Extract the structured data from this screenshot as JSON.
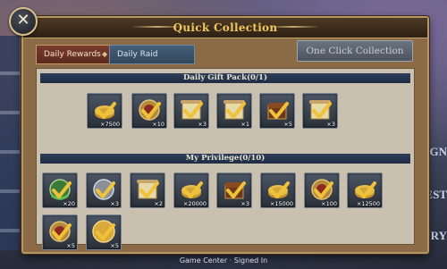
{
  "window": {
    "title": "Quick Collection"
  },
  "tabs": [
    {
      "label": "Daily Rewards",
      "active": true
    },
    {
      "label": "Daily Raid",
      "active": false
    }
  ],
  "one_click_label": "One Click Collection",
  "daily_gift": {
    "header": "Daily Gift Pack(0/1)",
    "items": [
      {
        "icon": "gold-coins-icon",
        "qty": "×7500"
      },
      {
        "icon": "medal-badge-icon",
        "qty": "×10"
      },
      {
        "icon": "scroll-icon",
        "qty": "×3"
      },
      {
        "icon": "scroll-icon",
        "qty": "×1"
      },
      {
        "icon": "chest-icon",
        "qty": "×5"
      },
      {
        "icon": "scroll-icon",
        "qty": "×3"
      }
    ]
  },
  "privilege": {
    "header": "My Privilege(0/10)",
    "items": [
      {
        "icon": "green-emblem-icon",
        "qty": "×20"
      },
      {
        "icon": "silver-shield-icon",
        "qty": "×3"
      },
      {
        "icon": "scroll-icon",
        "qty": "×2"
      },
      {
        "icon": "gold-coins-icon",
        "qty": "×20000"
      },
      {
        "icon": "chest-icon",
        "qty": "×3"
      },
      {
        "icon": "gold-coins-icon",
        "qty": "×15000"
      },
      {
        "icon": "medal-badge-icon",
        "qty": "×100"
      },
      {
        "icon": "gold-coins-icon",
        "qty": "×12500"
      },
      {
        "icon": "medal-badge-icon",
        "qty": "×5"
      },
      {
        "icon": "gold-medal-icon",
        "qty": "×5"
      }
    ]
  },
  "background_labels": {
    "right_1": "IGN",
    "right_2": "EST",
    "right_3": "ORY"
  },
  "footer": "Game Center · Signed In",
  "colors": {
    "panel": "#8a6b45",
    "title": "#f2c85e",
    "section_bar": "#2f3f5a",
    "check": "#f0c23a"
  }
}
